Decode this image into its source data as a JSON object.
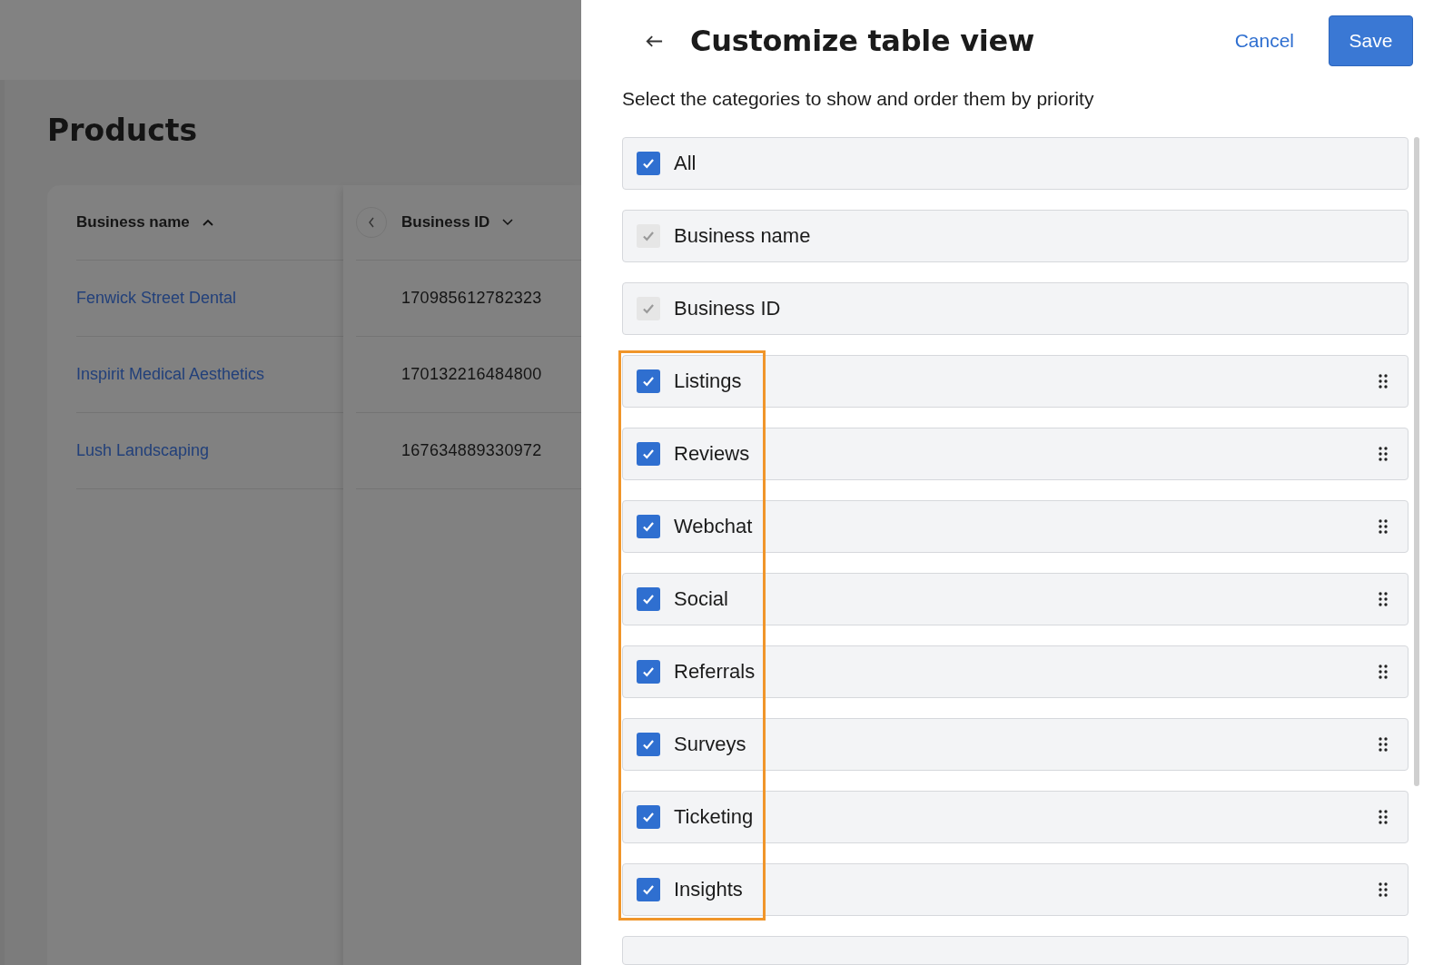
{
  "page": {
    "title": "Products"
  },
  "table": {
    "columns": [
      {
        "label": "Business name",
        "ascending": true
      },
      {
        "label": "Business ID",
        "ascending": false
      }
    ],
    "rows": [
      {
        "name": "Fenwick Street Dental",
        "id": "170985612782323"
      },
      {
        "name": "Inspirit Medical Aesthetics",
        "id": "170132216484800"
      },
      {
        "name": "Lush Landscaping",
        "id": "167634889330972"
      }
    ]
  },
  "panel": {
    "title": "Customize table view",
    "cancel": "Cancel",
    "save": "Save",
    "subtitle": "Select the categories to show and order them by priority",
    "items": [
      {
        "label": "All",
        "kind": "all",
        "checked": true
      },
      {
        "label": "Business name",
        "kind": "fixed",
        "checked": true
      },
      {
        "label": "Business ID",
        "kind": "fixed",
        "checked": true
      }
    ],
    "highlighted_items": [
      {
        "label": "Listings",
        "kind": "movable",
        "checked": true
      },
      {
        "label": "Reviews",
        "kind": "movable",
        "checked": true
      },
      {
        "label": "Webchat",
        "kind": "movable",
        "checked": true
      },
      {
        "label": "Social",
        "kind": "movable",
        "checked": true
      },
      {
        "label": "Referrals",
        "kind": "movable",
        "checked": true
      },
      {
        "label": "Surveys",
        "kind": "movable",
        "checked": true
      },
      {
        "label": "Ticketing",
        "kind": "movable",
        "checked": true
      },
      {
        "label": "Insights",
        "kind": "movable",
        "checked": true
      }
    ]
  }
}
